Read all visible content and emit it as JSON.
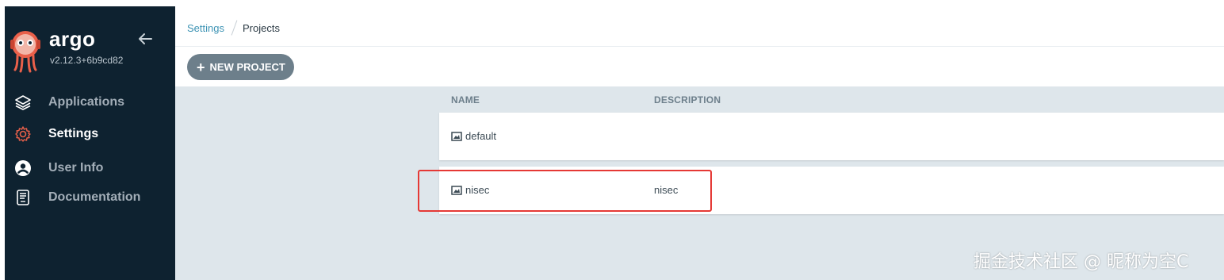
{
  "app": {
    "name": "argo",
    "version": "v2.12.3+6b9cd82"
  },
  "sidebar": {
    "items": [
      {
        "label": "Applications",
        "icon": "layers-icon",
        "active": false
      },
      {
        "label": "Settings",
        "icon": "gear-icon",
        "active": true
      },
      {
        "label": "User Info",
        "icon": "user-icon",
        "active": false
      },
      {
        "label": "Documentation",
        "icon": "book-icon",
        "active": false
      }
    ]
  },
  "breadcrumb": {
    "parent": "Settings",
    "current": "Projects"
  },
  "toolbar": {
    "new_project_label": "NEW PROJECT"
  },
  "table": {
    "columns": [
      "NAME",
      "DESCRIPTION"
    ],
    "rows": [
      {
        "name": "default",
        "description": ""
      },
      {
        "name": "nisec",
        "description": "nisec"
      }
    ]
  },
  "watermark": "掘金技术社区 @ 昵称为空C",
  "colors": {
    "sidebar_bg": "#0e2230",
    "accent": "#3d93b4",
    "active_icon": "#e9604a",
    "button_bg": "#6d7f8b",
    "content_bg": "#dee6eb",
    "highlight": "#e53935"
  }
}
